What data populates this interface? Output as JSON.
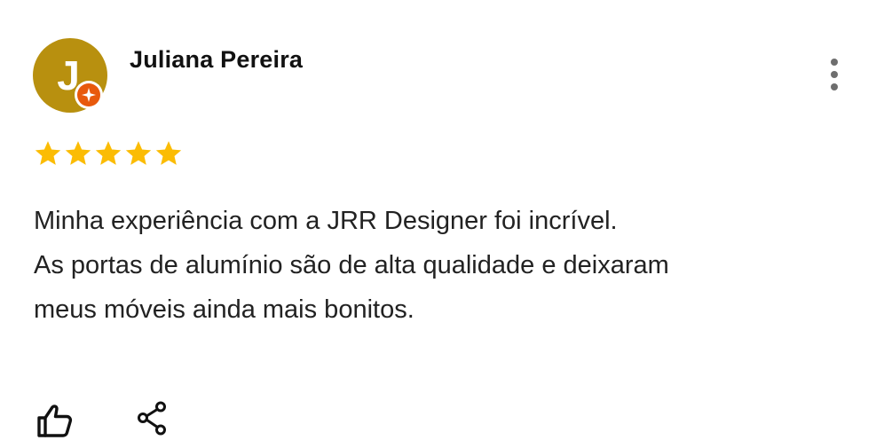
{
  "reviewer": {
    "initial": "J",
    "name": "Juliana Pereira",
    "avatar_color": "#b8900f",
    "badge_icon": "local-guide-star-icon",
    "badge_color": "#e8590c"
  },
  "rating": {
    "stars": 5,
    "max": 5,
    "star_color": "#fbbc04"
  },
  "review": {
    "lines": [
      "Minha experiência com a JRR Designer foi incrível.",
      "As portas de alumínio são de alta qualidade e deixaram",
      "meus móveis ainda mais bonitos."
    ]
  },
  "actions": {
    "more_icon": "more-vertical-icon",
    "like_icon": "thumbs-up-icon",
    "share_icon": "share-icon"
  }
}
